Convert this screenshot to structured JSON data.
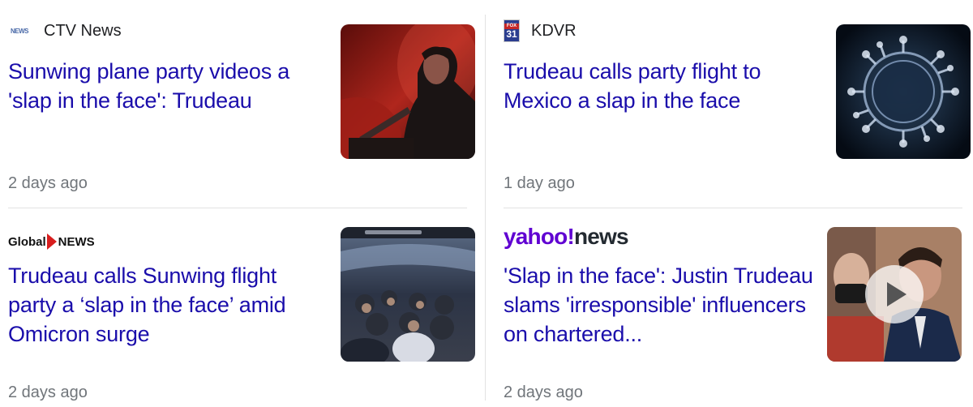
{
  "cards": [
    {
      "source": "CTV News",
      "source_logo_text": "NEWS",
      "headline": "Sunwing plane party videos a 'slap in the face': Trudeau",
      "time": "2 days ago",
      "thumb_icon": "trudeau-podium-photo"
    },
    {
      "source": "KDVR",
      "source_logo_text": "31",
      "headline": "Trudeau calls party flight to Mexico a slap in the face",
      "time": "1 day ago",
      "thumb_icon": "virus-illustration"
    },
    {
      "source_logo_text_a": "Global",
      "source_logo_text_b": "NEWS",
      "headline": "Trudeau calls Sunwing flight party a ‘slap in the face’ amid Omicron surge",
      "time": "2 days ago",
      "thumb_icon": "plane-cabin-party-photo"
    },
    {
      "source_logo_text_a": "yahoo!",
      "source_logo_text_b": "news",
      "headline": "'Slap in the face': Justin Trudeau slams 'irresponsible' influencers on chartered...",
      "time": "2 days ago",
      "thumb_icon": "video-thumbnail-trudeau"
    }
  ],
  "colors": {
    "headline": "#1a0dab",
    "meta": "#70757a",
    "yahoo_purple": "#6001d2",
    "global_red": "#d81e1e"
  }
}
